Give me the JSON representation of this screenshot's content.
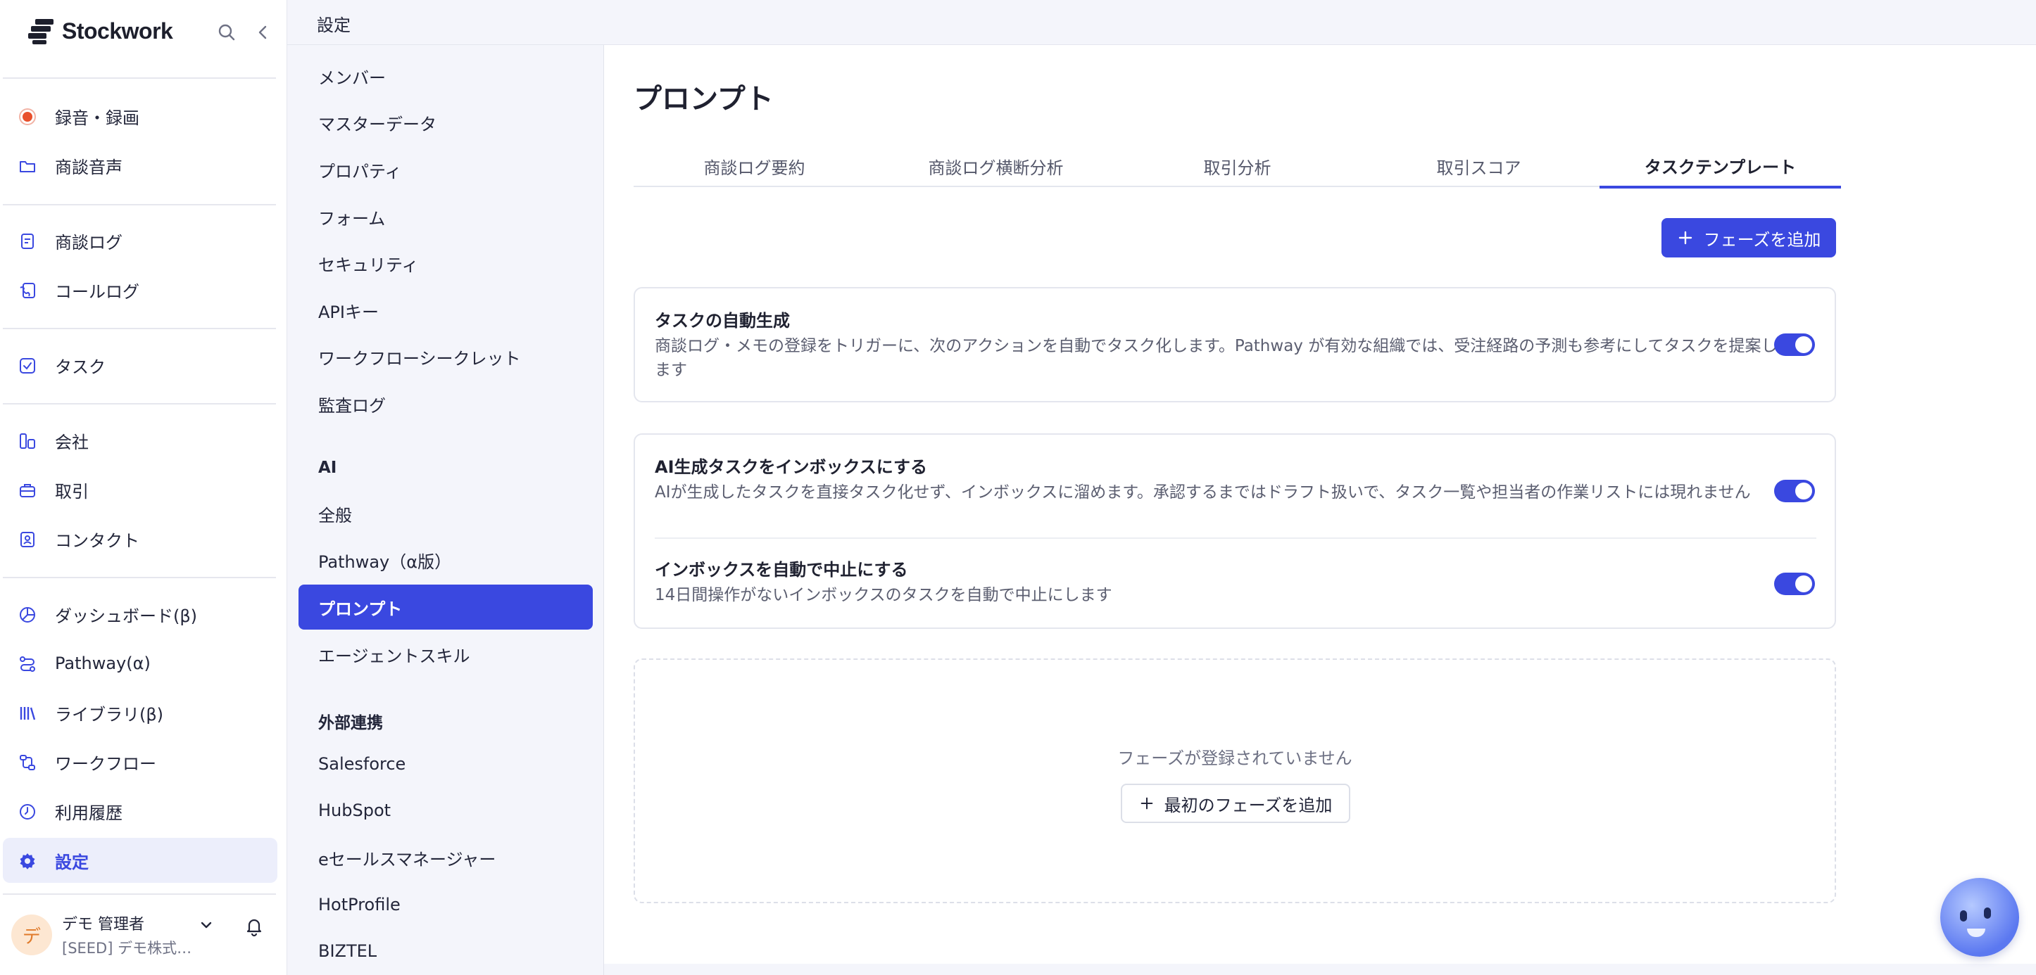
{
  "app": {
    "brand": "Stockwork"
  },
  "topbar": {
    "breadcrumb": "設定"
  },
  "sidebar": {
    "groups": [
      [
        {
          "label": "録音・録画",
          "icon": "record-icon"
        },
        {
          "label": "商談音声",
          "icon": "folder-icon"
        }
      ],
      [
        {
          "label": "商談ログ",
          "icon": "document-icon"
        },
        {
          "label": "コールログ",
          "icon": "phone-log-icon"
        }
      ],
      [
        {
          "label": "タスク",
          "icon": "checkbox-icon"
        }
      ],
      [
        {
          "label": "会社",
          "icon": "building-icon"
        },
        {
          "label": "取引",
          "icon": "briefcase-icon"
        },
        {
          "label": "コンタクト",
          "icon": "contact-card-icon"
        }
      ],
      [
        {
          "label": "ダッシュボード(β)",
          "icon": "chart-pie-icon"
        },
        {
          "label": "Pathway(α)",
          "icon": "pathway-icon"
        },
        {
          "label": "ライブラリ(β)",
          "icon": "library-icon"
        },
        {
          "label": "ワークフロー",
          "icon": "workflow-icon"
        },
        {
          "label": "利用履歴",
          "icon": "clock-icon"
        },
        {
          "label": "設定",
          "icon": "gear-icon",
          "active": true
        }
      ]
    ],
    "user": {
      "avatar_initial": "デ",
      "name": "デモ 管理者",
      "org": "[SEED] デモ株式…"
    }
  },
  "submenu": {
    "general": [
      "メンバー",
      "マスターデータ",
      "プロパティ",
      "フォーム",
      "セキュリティ",
      "APIキー",
      "ワークフローシークレット",
      "監査ログ"
    ],
    "ai_heading": "AI",
    "ai": [
      "全般",
      "Pathway（α版）",
      "プロンプト",
      "エージェントスキル"
    ],
    "ext_heading": "外部連携",
    "ext": [
      "Salesforce",
      "HubSpot",
      "eセールスマネージャー",
      "HotProfile",
      "BIZTEL"
    ]
  },
  "main": {
    "title": "プロンプト",
    "tabs": [
      "商談ログ要約",
      "商談ログ横断分析",
      "取引分析",
      "取引スコア",
      "タスクテンプレート"
    ],
    "active_tab": 4,
    "add_phase_label": "フェーズを追加",
    "settings": [
      {
        "title": "タスクの自動生成",
        "desc": "商談ログ・メモの登録をトリガーに、次のアクションを自動でタスク化します。Pathway が有効な組織では、受注経路の予測も参考にしてタスクを提案します",
        "enabled": true
      },
      {
        "title": "AI生成タスクをインボックスにする",
        "desc": "AIが生成したタスクを直接タスク化せず、インボックスに溜めます。承認するまではドラフト扱いで、タスク一覧や担当者の作業リストには現れません",
        "enabled": true
      },
      {
        "title": "インボックスを自動で中止にする",
        "desc": "14日間操作がないインボックスのタスクを自動で中止にします",
        "enabled": true
      }
    ],
    "empty_message": "フェーズが登録されていません",
    "first_phase_label": "最初のフェーズを追加"
  },
  "colors": {
    "accent": "#3a48e0",
    "record": "#e8502c"
  }
}
